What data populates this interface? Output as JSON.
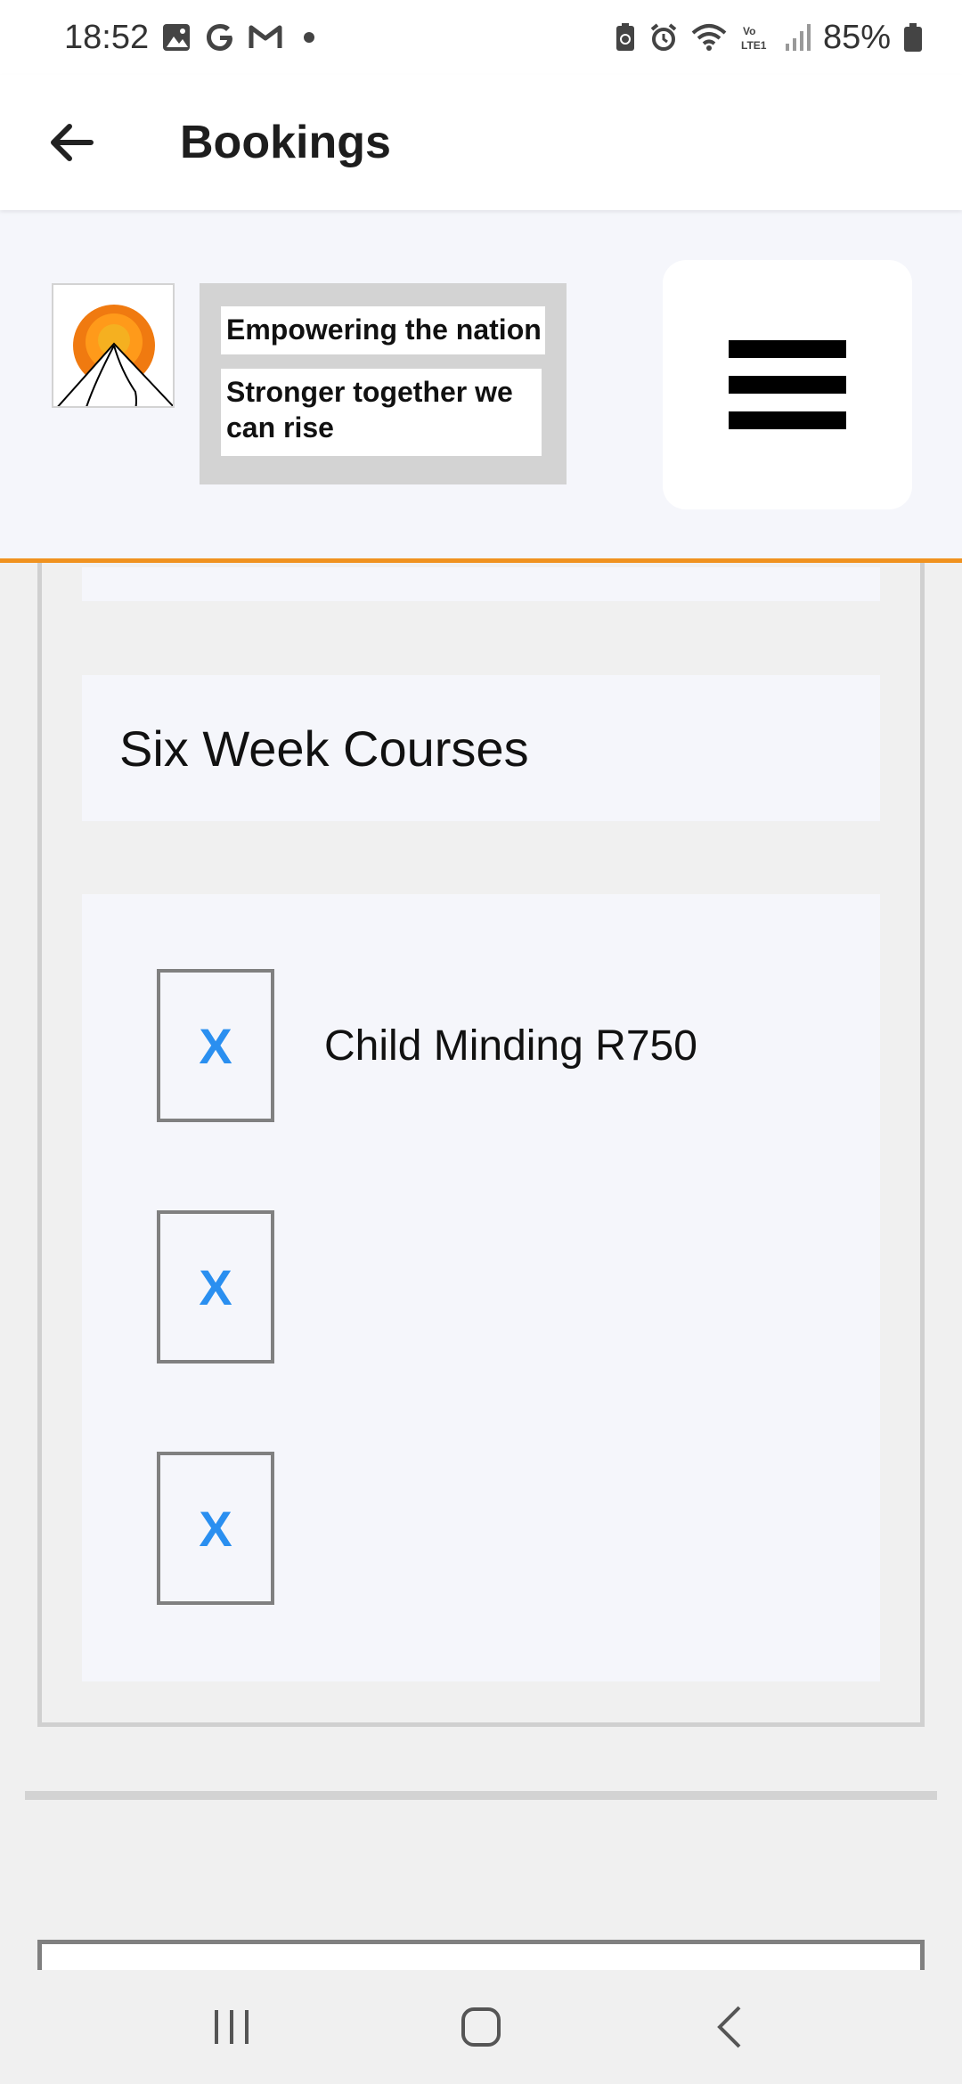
{
  "status_bar": {
    "time": "18:52",
    "battery": "85%",
    "left_icons": [
      "gallery-icon",
      "google-icon",
      "gmail-icon"
    ],
    "right_icons": [
      "battery-saver-icon",
      "alarm-icon",
      "wifi-icon",
      "volte-icon",
      "signal-icon",
      "battery-icon"
    ]
  },
  "app_bar": {
    "title": "Bookings",
    "back_icon": "arrow-left-icon"
  },
  "header": {
    "tagline_1": "Empowering the nation",
    "tagline_2": "Stronger together we can rise",
    "menu_icon": "hamburger-menu-icon"
  },
  "section": {
    "title": "Six Week Courses"
  },
  "courses": [
    {
      "remove_label": "X",
      "label": "Child Minding R750"
    },
    {
      "remove_label": "X",
      "label": ""
    },
    {
      "remove_label": "X",
      "label": ""
    }
  ],
  "nav_bar": {
    "icons": [
      "recent-apps-icon",
      "home-icon",
      "back-icon"
    ]
  },
  "colors": {
    "accent_orange": "#f0921f",
    "remove_blue": "#2a8ff0",
    "card_bg": "#f5f6fb",
    "frame_grey": "#d0d0d0"
  }
}
